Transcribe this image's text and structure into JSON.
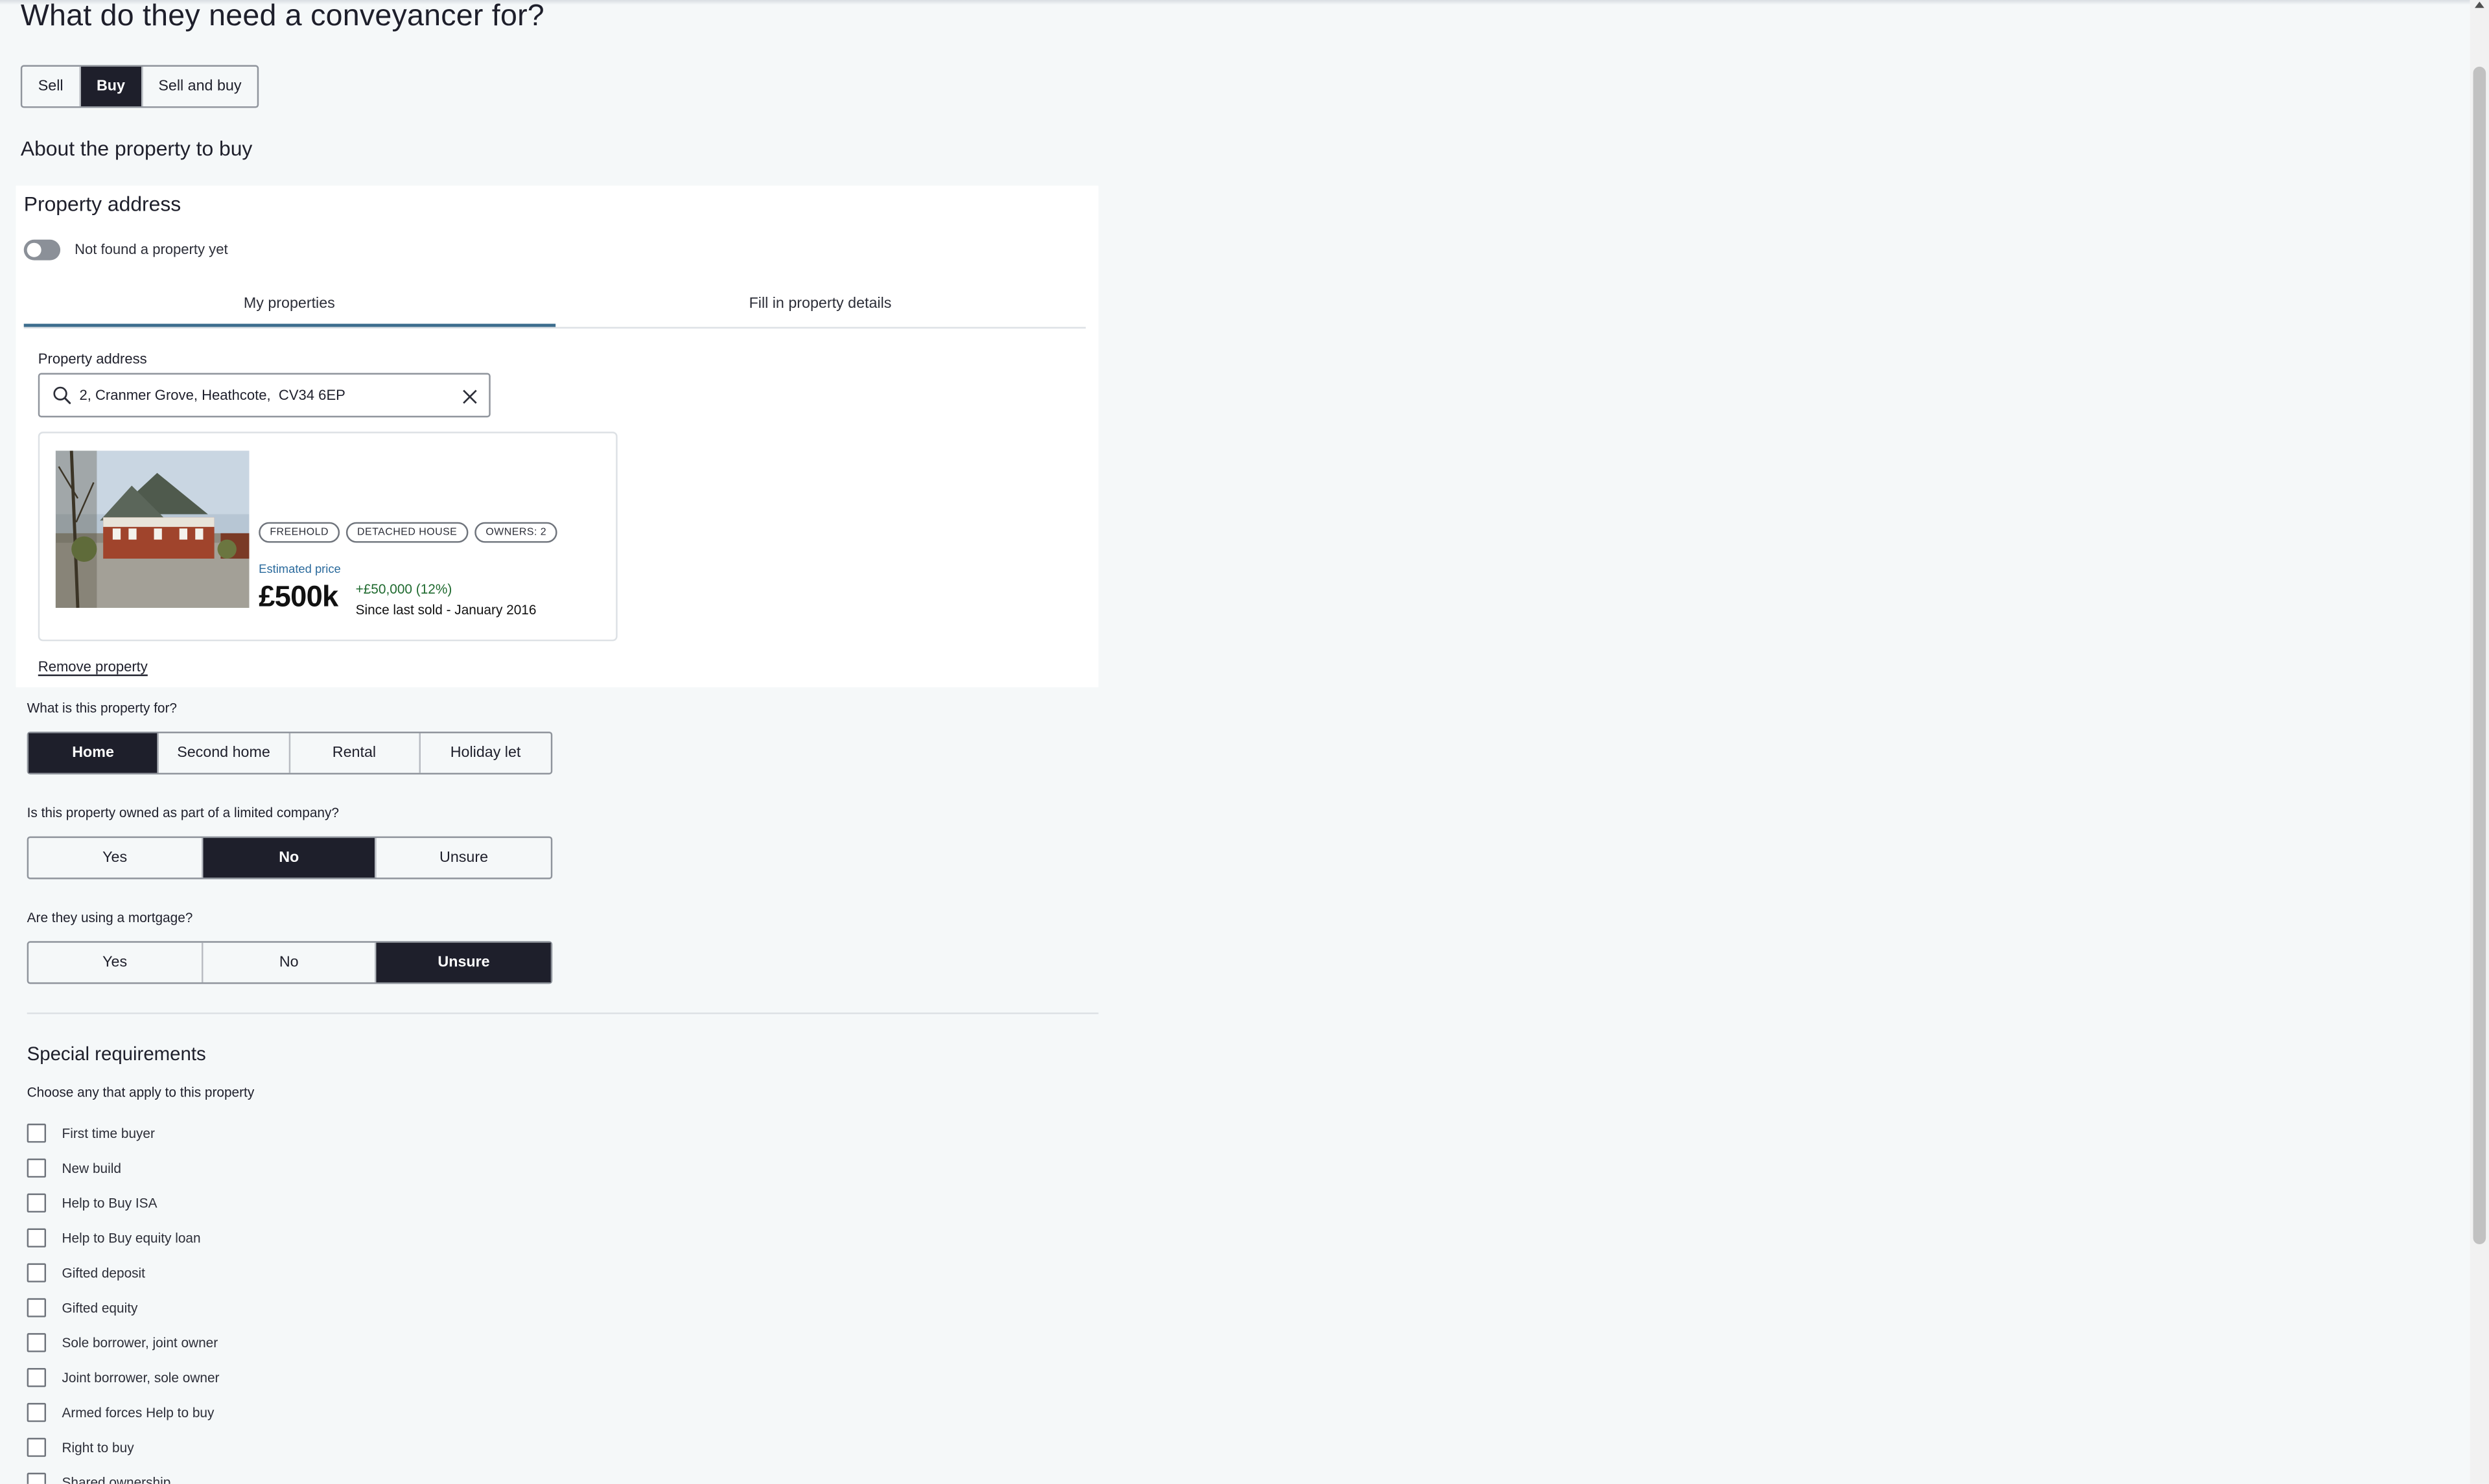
{
  "page": {
    "title": "What do they need a conveyancer for?"
  },
  "flow_tabs": {
    "options": [
      "Sell",
      "Buy",
      "Sell and buy"
    ],
    "selected": "Buy"
  },
  "section": {
    "title": "About the property to buy"
  },
  "address_card": {
    "title": "Property address",
    "toggle_label": "Not found a property yet",
    "toggle_on": false,
    "tabs": [
      "My properties",
      "Fill in property details"
    ],
    "active_tab": "My properties",
    "field_label": "Property address",
    "address_value": "2, Cranmer Grove, Heathcote,  CV34 6EP",
    "property": {
      "chips": [
        "FREEHOLD",
        "DETACHED HOUSE",
        "OWNERS: 2"
      ],
      "estimated_label": "Estimated price",
      "price": "£500k",
      "change": "+£50,000 (12%)",
      "since": "Since last sold - January 2016",
      "change_color": "#1f6a2f",
      "estimate_color": "#2a6a9c"
    },
    "remove_label": "Remove property"
  },
  "questions": [
    {
      "label": "What is this property for?",
      "options": [
        "Home",
        "Second home",
        "Rental",
        "Holiday let"
      ],
      "selected": "Home"
    },
    {
      "label": "Is this property owned as part of a limited company?",
      "options": [
        "Yes",
        "No",
        "Unsure"
      ],
      "selected": "No"
    },
    {
      "label": "Are they using a mortgage?",
      "options": [
        "Yes",
        "No",
        "Unsure"
      ],
      "selected": "Unsure"
    }
  ],
  "special": {
    "title": "Special requirements",
    "subtitle": "Choose any that apply to this property",
    "items": [
      "First time buyer",
      "New build",
      "Help to Buy ISA",
      "Help to Buy equity loan",
      "Gifted deposit",
      "Gifted equity",
      "Sole borrower, joint owner",
      "Joint borrower, sole owner",
      "Armed forces Help to buy",
      "Right to buy",
      "Shared ownership"
    ]
  },
  "theme": {
    "selected_bg": "#1e1f2b",
    "page_bg": "#f5f8f9",
    "tab_underline": "#3d6d8e"
  },
  "icons": {
    "search": "search-icon",
    "clear": "close-icon"
  }
}
